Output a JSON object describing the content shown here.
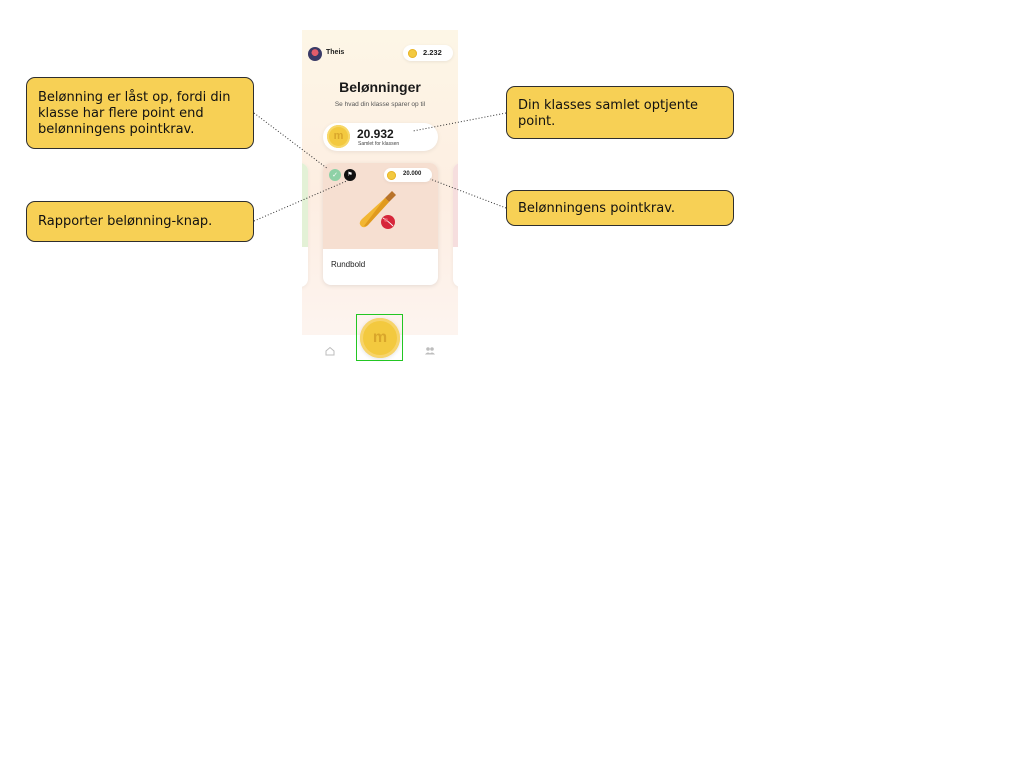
{
  "user": {
    "name": "Theis",
    "balance": "2.232"
  },
  "header": {
    "title": "Belønninger",
    "subtitle": "Se hvad din klasse sparer op til"
  },
  "class_total": {
    "value": "20.932",
    "label": "Samlet for klassen"
  },
  "reward": {
    "name": "Rundbold",
    "cost": "20.000",
    "report_icon": "flag-icon",
    "unlocked_icon": "unlock-icon"
  },
  "coin": {
    "symbol": "m"
  },
  "nav": {
    "home_icon": "home-icon",
    "center_icon": "coin-icon",
    "community_icon": "community-icon"
  },
  "callouts": {
    "unlocked": "Belønning er låst op, fordi din klasse har flere point end belønningens pointkrav.",
    "report": "Rapporter belønning-knap.",
    "total": "Din klasses samlet optjente point.",
    "cost": "Belønningens pointkrav."
  },
  "colors": {
    "callout": "#f7d055",
    "coin": "#f3c93f",
    "highlight": "#23c623",
    "card_bg": "#f6dfd1"
  }
}
